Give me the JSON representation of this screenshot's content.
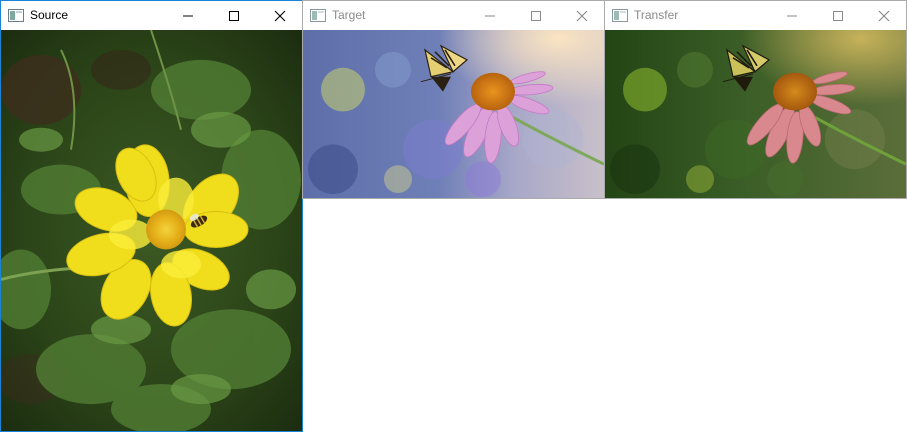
{
  "windows": [
    {
      "title": "Source",
      "state": "active",
      "icons": [
        "app-icon",
        "minimize-icon",
        "maximize-icon",
        "close-icon"
      ]
    },
    {
      "title": "Target",
      "state": "inactive",
      "icons": [
        "app-icon",
        "minimize-icon",
        "maximize-icon",
        "close-icon"
      ]
    },
    {
      "title": "Transfer",
      "state": "inactive",
      "icons": [
        "app-icon",
        "minimize-icon",
        "maximize-icon",
        "close-icon"
      ]
    }
  ],
  "colors": {
    "active_border": "#1883d7",
    "inactive_border": "#aaaaaa",
    "active_title_text": "#000000",
    "inactive_title_text": "#8a8a8a"
  }
}
